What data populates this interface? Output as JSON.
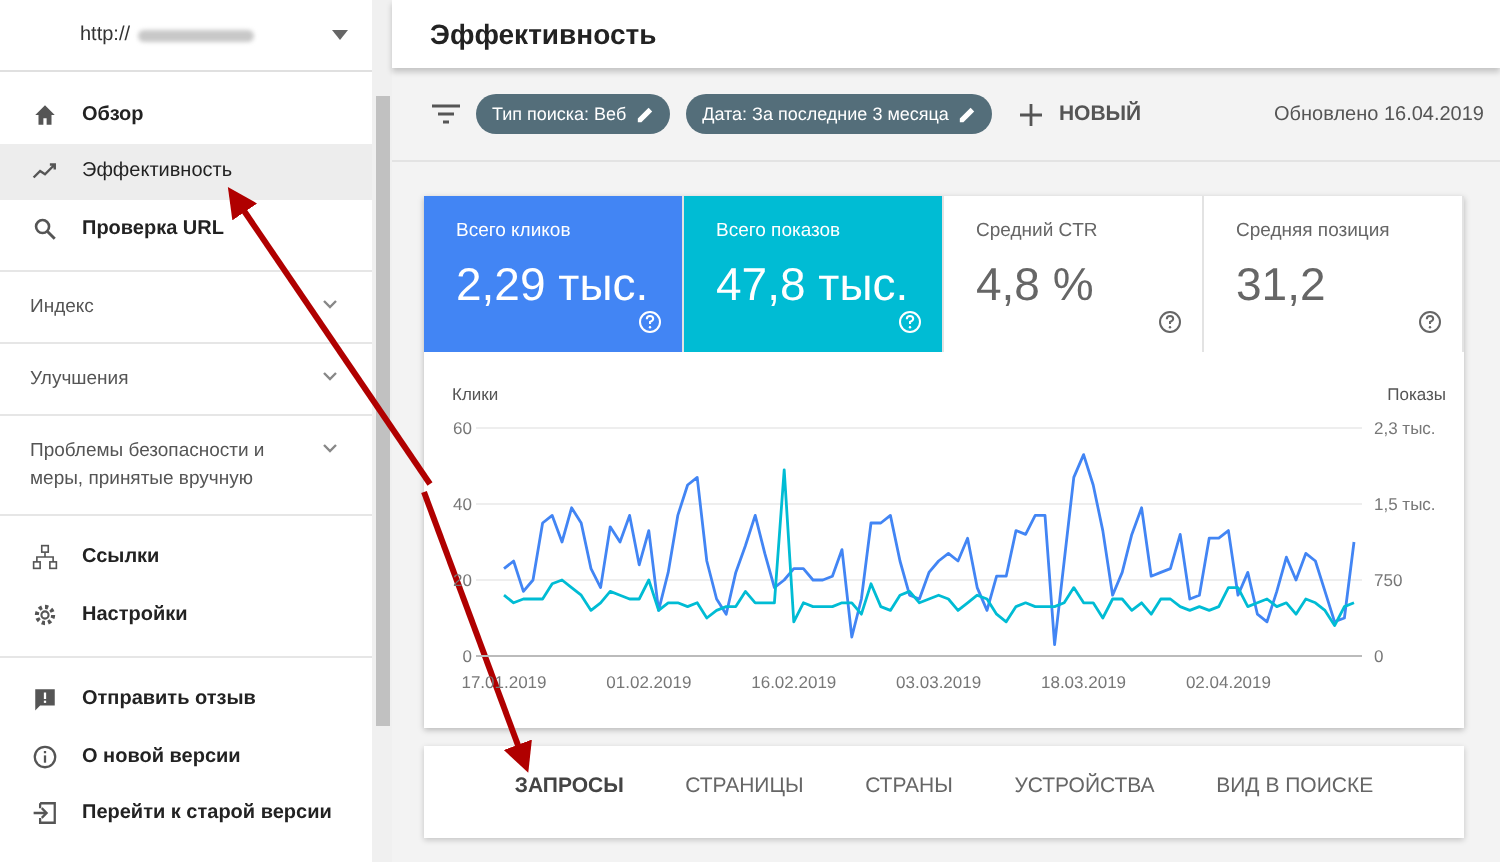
{
  "property": {
    "url": "http://"
  },
  "sidebar": {
    "items": [
      {
        "kind": "nav",
        "label": "Обзор",
        "selected": false
      },
      {
        "kind": "nav",
        "label": "Эффективность",
        "selected": true
      },
      {
        "kind": "nav",
        "label": "Проверка URL",
        "selected": false
      },
      {
        "kind": "section",
        "label": "Индекс",
        "expanded": false
      },
      {
        "kind": "section",
        "label": "Улучшения",
        "expanded": false
      },
      {
        "kind": "section",
        "label": "Проблемы безопасности и меры, принятые вручную",
        "expanded": false
      },
      {
        "kind": "nav",
        "label": "Ссылки",
        "selected": false
      },
      {
        "kind": "nav",
        "label": "Настройки",
        "selected": false
      },
      {
        "kind": "divider"
      },
      {
        "kind": "nav",
        "label": "Отправить отзыв",
        "selected": false
      },
      {
        "kind": "nav",
        "label": "О новой версии",
        "selected": false
      },
      {
        "kind": "nav",
        "label": "Перейти к старой версии",
        "selected": false
      }
    ]
  },
  "page_title": "Эффективность",
  "filters": {
    "chips": [
      "Тип поиска: Веб",
      "Дата: За последние 3 месяца"
    ],
    "new_button": "НОВЫЙ",
    "updated": "Обновлено 16.04.2019"
  },
  "metrics": [
    {
      "label": "Всего кликов",
      "value": "2,29 тыс.",
      "selected": true,
      "color": "#4285f4"
    },
    {
      "label": "Всего показов",
      "value": "47,8 тыс.",
      "selected": true,
      "color": "#00bcd4"
    },
    {
      "label": "Средний CTR",
      "value": "4,8 %",
      "selected": false
    },
    {
      "label": "Средняя позиция",
      "value": "31,2",
      "selected": false
    }
  ],
  "chart": {
    "right_axis_title": "Показы",
    "right_ticks": [
      "2,3 тыс.",
      "1,5 тыс.",
      "750",
      "0"
    ],
    "x_labels": [
      "17.01.2019",
      "01.02.2019",
      "16.02.2019",
      "03.03.2019",
      "18.03.2019",
      "02.04.2019"
    ],
    "chart_data": {
      "type": "line",
      "ylabel": "Клики",
      "ylim": [
        0,
        60
      ],
      "yticks": [
        0,
        20,
        40,
        60
      ],
      "series": [
        {
          "color": "#4285f4",
          "values": [
            23,
            25,
            17,
            20,
            35,
            37,
            30,
            39,
            35,
            23,
            18,
            34,
            30,
            37,
            24,
            33,
            12,
            22,
            37,
            45,
            47,
            25,
            15,
            11,
            22,
            29,
            37,
            27,
            18,
            20,
            23,
            23,
            20,
            20,
            21,
            28,
            5,
            15,
            35,
            35,
            37,
            25,
            16,
            15,
            22,
            25,
            27,
            25,
            31,
            18,
            12,
            21,
            21,
            33,
            32,
            37,
            37,
            3,
            25,
            47,
            53,
            45,
            33,
            16,
            22,
            32,
            39,
            21,
            22,
            23,
            32,
            15,
            16,
            31,
            31,
            33,
            16,
            22,
            11,
            9,
            17,
            26,
            20,
            27,
            25,
            17,
            9,
            10,
            30
          ]
        },
        {
          "color": "#00bcd4",
          "values": [
            16,
            14,
            15,
            15,
            15,
            19,
            20,
            18,
            16,
            12,
            14,
            17,
            16,
            15,
            15,
            20,
            12,
            14,
            14,
            13,
            14,
            10,
            12,
            13,
            13,
            17,
            14,
            14,
            14,
            49,
            9,
            14,
            13,
            13,
            13,
            14,
            14,
            11,
            19,
            13,
            12,
            16,
            17,
            14,
            15,
            16,
            15,
            12,
            14,
            16,
            15,
            11,
            9,
            13,
            14,
            13,
            13,
            13,
            14,
            18,
            14,
            14,
            10,
            15,
            15,
            12,
            14,
            11,
            15,
            15,
            13,
            12,
            13,
            12,
            13,
            18,
            18,
            13,
            14,
            15,
            13,
            14,
            11,
            15,
            14,
            12,
            8,
            13,
            14
          ]
        }
      ]
    }
  },
  "report_tabs": [
    {
      "label": "ЗАПРОСЫ",
      "selected": true
    },
    {
      "label": "СТРАНИЦЫ",
      "selected": false
    },
    {
      "label": "СТРАНЫ",
      "selected": false
    },
    {
      "label": "УСТРОЙСТВА",
      "selected": false
    },
    {
      "label": "ВИД В ПОИСКЕ",
      "selected": false
    }
  ]
}
